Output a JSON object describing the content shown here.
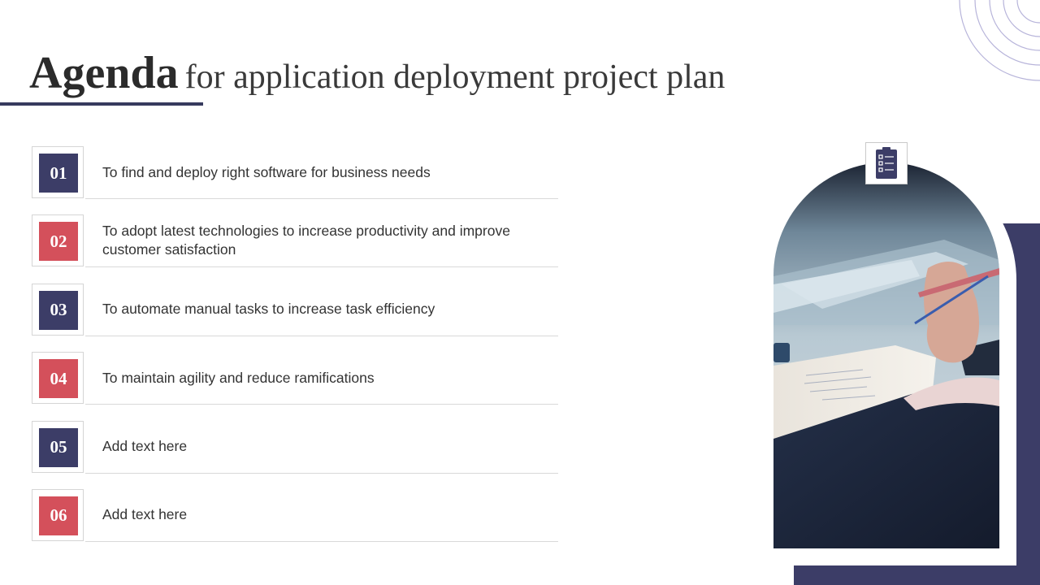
{
  "title": {
    "bold": "Agenda",
    "rest": "for application deployment project plan"
  },
  "agenda": [
    {
      "number": "01",
      "text": "To find and deploy right software for business needs",
      "color": "#3c3d67"
    },
    {
      "number": "02",
      "text": "To adopt latest technologies to increase productivity and improve customer satisfaction",
      "color": "#d4505b"
    },
    {
      "number": "03",
      "text": "To automate manual tasks to increase task efficiency",
      "color": "#3c3d67"
    },
    {
      "number": "04",
      "text": "To maintain agility and reduce ramifications",
      "color": "#d4505b"
    },
    {
      "number": "05",
      "text": "Add text here",
      "color": "#3c3d67"
    },
    {
      "number": "06",
      "text": "Add text here",
      "color": "#d4505b"
    }
  ],
  "icons": {
    "header_icon": "clipboard-checklist-icon",
    "decoration": "concentric-circles"
  },
  "colors": {
    "navy": "#3c3d67",
    "red": "#d4505b",
    "divider": "#d9d9d9",
    "circles": "#b7b4da"
  }
}
